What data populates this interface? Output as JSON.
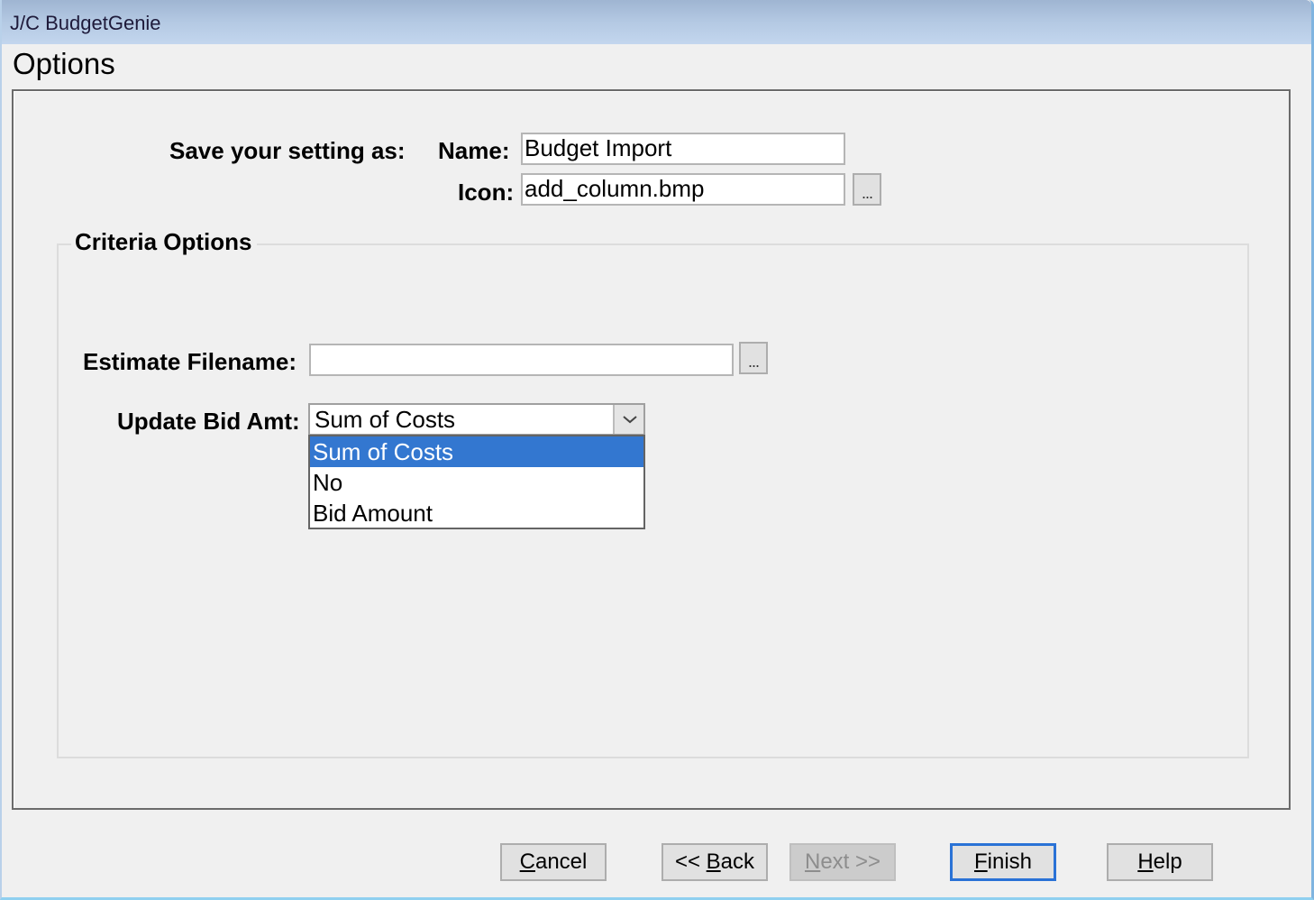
{
  "window": {
    "title": "J/C BudgetGenie"
  },
  "page": {
    "heading": "Options"
  },
  "save_settings": {
    "section_label": "Save your setting as:",
    "name_label": "Name:",
    "name_value": "Budget Import",
    "icon_label": "Icon:",
    "icon_value": "add_column.bmp",
    "icon_browse_label": "..."
  },
  "criteria": {
    "group_title": "Criteria Options",
    "estimate_filename_label": "Estimate Filename:",
    "estimate_filename_value": "",
    "estimate_browse_label": "...",
    "update_bid_label": "Update Bid Amt:",
    "update_bid_value": "Sum of Costs",
    "update_bid_options": [
      {
        "label": "Sum of Costs",
        "selected": true
      },
      {
        "label": "No",
        "selected": false
      },
      {
        "label": "Bid Amount",
        "selected": false
      }
    ]
  },
  "buttons": {
    "cancel": {
      "mnemonic": "C",
      "rest": "ancel",
      "enabled": true
    },
    "back": {
      "prefix": "<< ",
      "mnemonic": "B",
      "rest": "ack",
      "enabled": true
    },
    "next": {
      "mnemonic": "N",
      "rest": "ext >>",
      "enabled": false
    },
    "finish": {
      "mnemonic": "F",
      "rest": "inish",
      "enabled": true,
      "default": true
    },
    "help": {
      "mnemonic": "H",
      "rest": "elp",
      "enabled": true
    }
  },
  "colors": {
    "selection": "#3377d0",
    "default_button_border": "#2a72d6"
  }
}
